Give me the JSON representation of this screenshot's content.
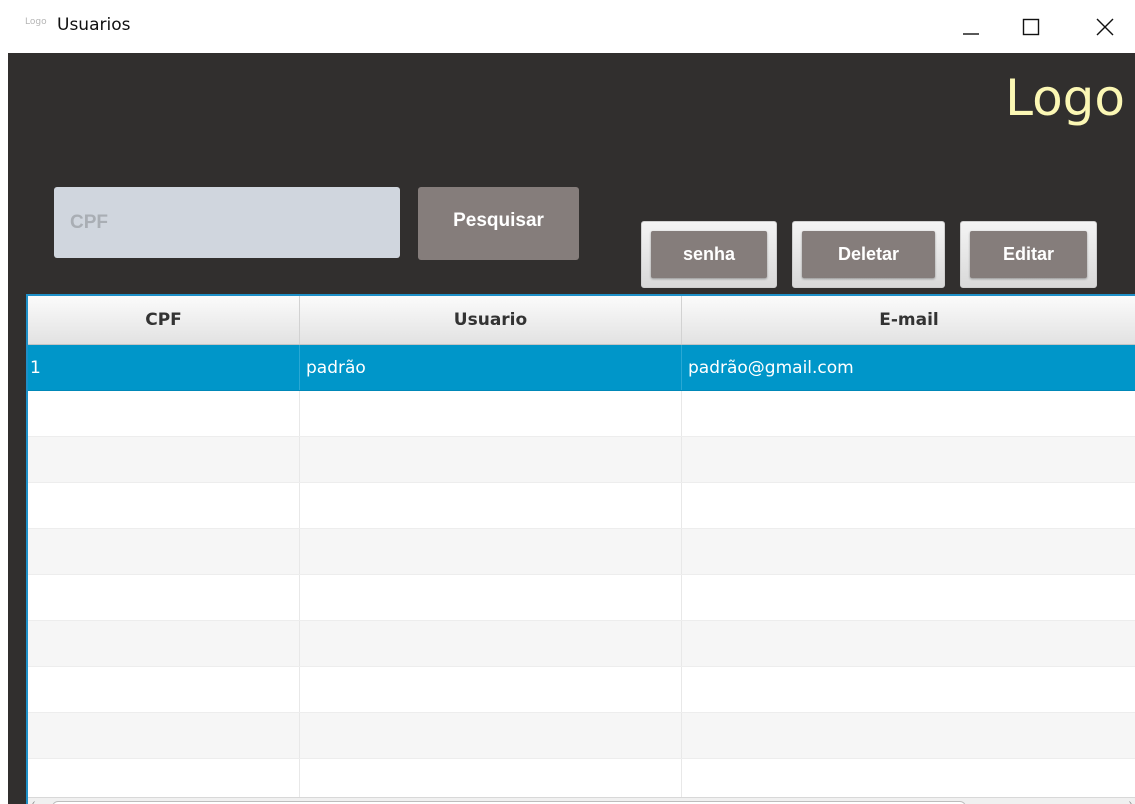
{
  "window": {
    "icon_text": "Logo",
    "title": "Usuarios",
    "controls": [
      "minimize",
      "maximize",
      "close"
    ]
  },
  "header": {
    "logo": "Logo"
  },
  "search": {
    "placeholder": "CPF",
    "value": "",
    "button_label": "Pesquisar"
  },
  "actions": {
    "senha_label": "senha",
    "delete_label": "Deletar",
    "edit_label": "Editar"
  },
  "table": {
    "columns": [
      "CPF",
      "Usuario",
      "E-mail"
    ],
    "rows": [
      {
        "cpf": "1",
        "usuario": "padrão",
        "email": "padrão@gmail.com",
        "selected": true
      }
    ]
  },
  "colors": {
    "background": "#312f2e",
    "logo": "#fbf7b4",
    "button": "#857d7b",
    "input": "#d0d6de",
    "selection": "#0096c9",
    "table_border": "#1e90c8"
  }
}
